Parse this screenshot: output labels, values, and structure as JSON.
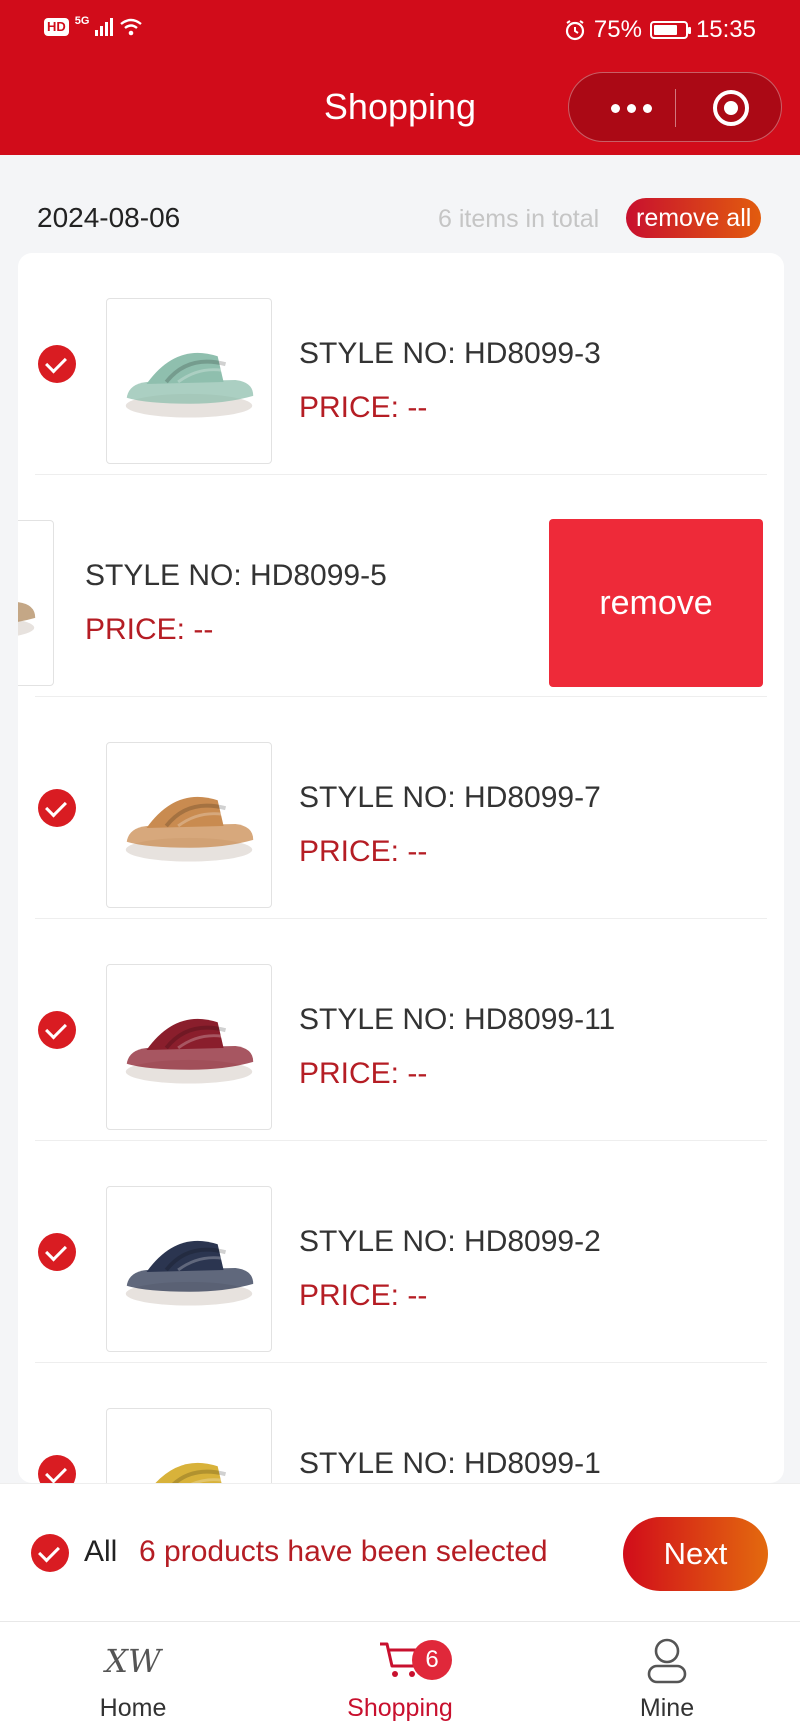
{
  "status_bar": {
    "network": "5G",
    "battery": "75%",
    "battery_level": 0.75,
    "time": "15:35"
  },
  "header": {
    "title": "Shopping"
  },
  "summary": {
    "date": "2024-08-06",
    "total_text": "6 items in total",
    "remove_all_label": "remove all"
  },
  "items": [
    {
      "style_no": "STYLE NO: HD8099-3",
      "price": "PRICE: --",
      "checked": true,
      "shoe_color": "#8fbfae"
    },
    {
      "style_no": "STYLE NO: HD8099-5",
      "price": "PRICE: --",
      "checked": true,
      "shoe_color": "#b08a5e"
    },
    {
      "style_no": "STYLE NO: HD8099-7",
      "price": "PRICE: --",
      "checked": true,
      "shoe_color": "#c98b50"
    },
    {
      "style_no": "STYLE NO: HD8099-11",
      "price": "PRICE: --",
      "checked": true,
      "shoe_color": "#8a1e2c"
    },
    {
      "style_no": "STYLE NO: HD8099-2",
      "price": "PRICE: --",
      "checked": true,
      "shoe_color": "#2b3550"
    },
    {
      "style_no": "STYLE NO: HD8099-1",
      "price": "",
      "checked": true,
      "shoe_color": "#d8b23a"
    }
  ],
  "swipe_action": {
    "label": "remove"
  },
  "selection_bar": {
    "all_label": "All",
    "selected_text": "6 products have been selected",
    "next_label": "Next"
  },
  "tabbar": {
    "home_label": "Home",
    "home_logo": "XW",
    "shopping_label": "Shopping",
    "shopping_badge": "6",
    "mine_label": "Mine"
  },
  "colors": {
    "brand_red": "#d10c1a",
    "price_red": "#b51d24",
    "remove_red": "#ee2a39",
    "gradient_orange": "#e36a0e"
  }
}
